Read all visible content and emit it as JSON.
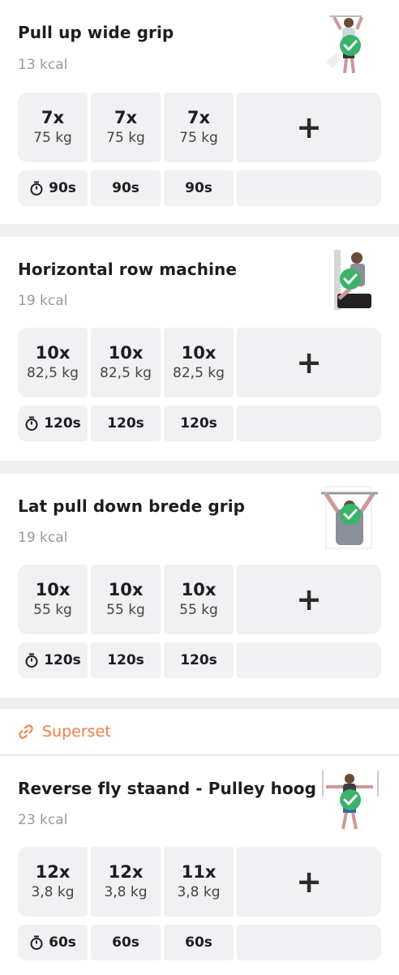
{
  "exercises": [
    {
      "title": "Pull up wide grip",
      "kcal": "13 kcal",
      "thumb_icon": "pull-up-figure",
      "sets": [
        {
          "reps": "7x",
          "weight": "75 kg"
        },
        {
          "reps": "7x",
          "weight": "75 kg"
        },
        {
          "reps": "7x",
          "weight": "75 kg"
        }
      ],
      "rest": [
        "90s",
        "90s",
        "90s"
      ]
    },
    {
      "title": "Horizontal row machine",
      "kcal": "19 kcal",
      "thumb_icon": "row-machine-figure",
      "sets": [
        {
          "reps": "10x",
          "weight": "82,5 kg"
        },
        {
          "reps": "10x",
          "weight": "82,5 kg"
        },
        {
          "reps": "10x",
          "weight": "82,5 kg"
        }
      ],
      "rest": [
        "120s",
        "120s",
        "120s"
      ]
    },
    {
      "title": "Lat pull down brede grip",
      "kcal": "19 kcal",
      "thumb_icon": "lat-pulldown-figure",
      "sets": [
        {
          "reps": "10x",
          "weight": "55 kg"
        },
        {
          "reps": "10x",
          "weight": "55 kg"
        },
        {
          "reps": "10x",
          "weight": "55 kg"
        }
      ],
      "rest": [
        "120s",
        "120s",
        "120s"
      ]
    },
    {
      "title": "Reverse fly staand - Pulley hoog",
      "kcal": "23 kcal",
      "thumb_icon": "reverse-fly-figure",
      "sets": [
        {
          "reps": "12x",
          "weight": "3,8 kg"
        },
        {
          "reps": "12x",
          "weight": "3,8 kg"
        },
        {
          "reps": "11x",
          "weight": "3,8 kg"
        }
      ],
      "rest": [
        "60s",
        "60s",
        "60s"
      ]
    }
  ],
  "superset": {
    "label": "Superset",
    "icon": "link-icon"
  },
  "add_label": "+",
  "colors": {
    "accent": "#f07c44",
    "check": "#3bb36a",
    "tile": "#f1f1f3",
    "divider": "#efefef"
  }
}
